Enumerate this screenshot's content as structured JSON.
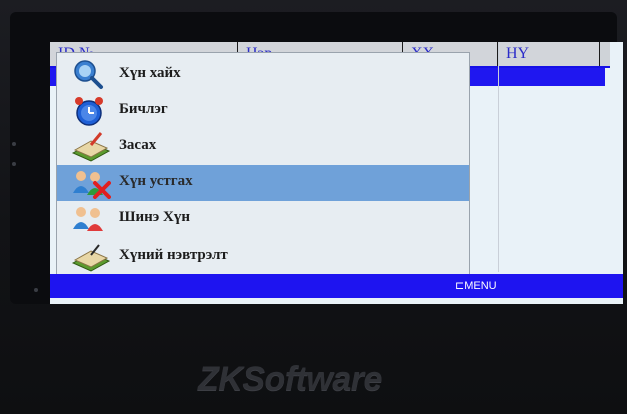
{
  "table": {
    "columns": [
      "ID №",
      "Нэр",
      "ХХ",
      "НҮ"
    ]
  },
  "menu": {
    "items": [
      {
        "label": "Хүн хайх",
        "icon": "search-user-icon",
        "highlighted": false
      },
      {
        "label": "Бичлэг",
        "icon": "alarm-clock-icon",
        "highlighted": false
      },
      {
        "label": "Засах",
        "icon": "edit-book-icon",
        "highlighted": false
      },
      {
        "label": "Хүн устгах",
        "icon": "delete-user-icon",
        "highlighted": true
      },
      {
        "label": "Шинэ Хүн",
        "icon": "new-user-icon",
        "highlighted": false
      },
      {
        "label": "Хүний нэвтрэлт",
        "icon": "access-book-icon",
        "highlighted": false
      }
    ]
  },
  "status_bar": {
    "hint": "⊏MENU"
  },
  "device": {
    "brand": "ZKSoftware"
  },
  "colors": {
    "accent_blue": "#1e14f0",
    "highlight": "#6fa1d9",
    "screen_bg": "#e9f2f8"
  }
}
